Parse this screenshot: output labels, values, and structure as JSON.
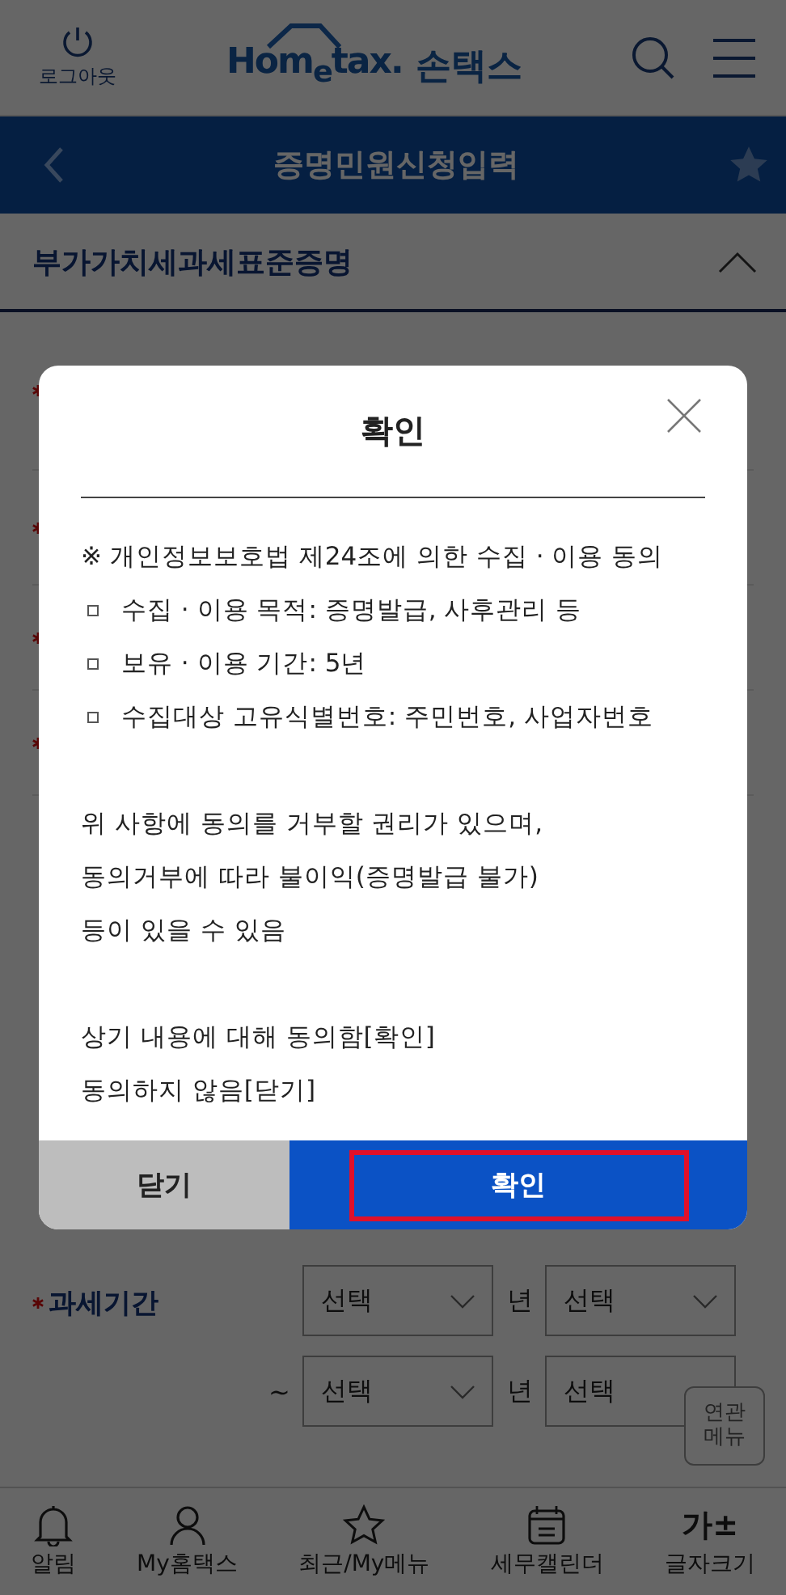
{
  "header": {
    "logout_label": "로그아웃",
    "logo_text": "Hom$_{e}$tax.",
    "logo_app": "손택스"
  },
  "title_bar": {
    "title": "증명민원신청입력",
    "favorite": false
  },
  "section": {
    "title": "부가가치세과세표준증명",
    "expanded": true
  },
  "hidden_rows": [
    {
      "required": true
    },
    {
      "required": true
    },
    {
      "required": true
    },
    {
      "required": true
    }
  ],
  "period": {
    "label": "과세기간",
    "required": true,
    "rows": [
      {
        "selects": [
          {
            "value": "선택",
            "unit": "년"
          },
          {
            "value": "선택"
          }
        ]
      },
      {
        "prefix": "~",
        "selects": [
          {
            "value": "선택",
            "unit": "년"
          },
          {
            "value": "선택"
          }
        ]
      }
    ]
  },
  "related_menu": "연관\n메뉴",
  "modal": {
    "title": "확인",
    "notice": "※ 개인정보보호법 제24조에 의한 수집 · 이용 동의",
    "items": [
      "수집 · 이용 목적: 증명발급, 사후관리 등",
      "보유 · 이용 기간: 5년",
      "수집대상 고유식별번호: 주민번호, 사업자번호"
    ],
    "paragraphs": [
      [
        "위 사항에 동의를 거부할 권리가 있으며,",
        "동의거부에 따라 불이익(증명발급 불가)",
        "등이 있을 수 있음"
      ],
      [
        "상기 내용에 대해 동의함[확인]",
        "동의하지 않음[닫기]"
      ]
    ],
    "buttons": [
      {
        "label": "닫기",
        "kind": "secondary",
        "highlighted": false
      },
      {
        "label": "확인",
        "kind": "primary",
        "highlighted": true
      }
    ]
  },
  "bottom_nav": [
    {
      "label": "알림"
    },
    {
      "label": "My홈택스"
    },
    {
      "label": "최근/My메뉴"
    },
    {
      "label": "세무캘린더"
    },
    {
      "label": "글자크기",
      "glyph": "가±"
    }
  ]
}
